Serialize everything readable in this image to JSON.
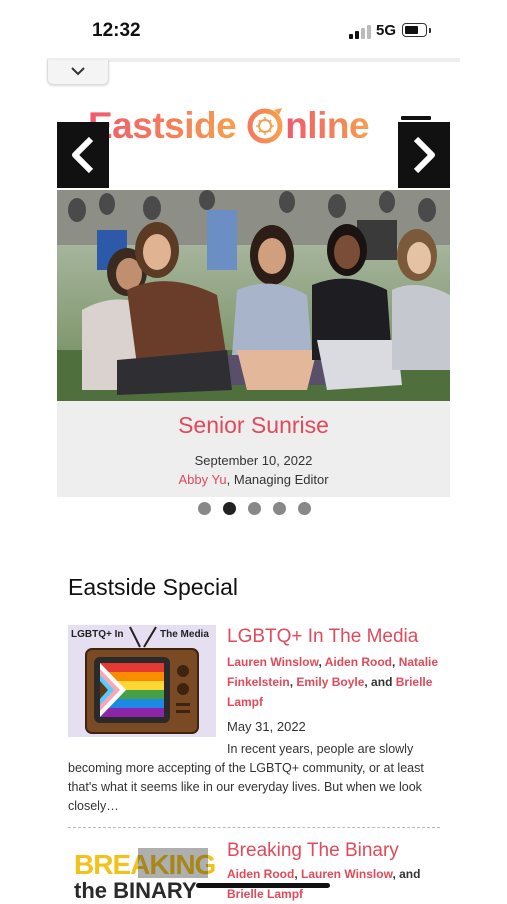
{
  "status_bar": {
    "time": "12:32",
    "network": "5G",
    "battery_percent": 70
  },
  "header": {
    "logo_text_before": "Eastside ",
    "logo_text_after": "nline",
    "menu_icon": "hamburger-icon",
    "collapse_icon": "chevron-down-icon"
  },
  "carousel": {
    "slide_title": "Senior Sunrise",
    "date": "September 10, 2022",
    "author": "Abby Yu",
    "author_role": ", Managing Editor",
    "prev_icon": "chevron-left-icon",
    "next_icon": "chevron-right-icon",
    "slide_count": 5,
    "active_index": 1
  },
  "section": {
    "title": "Eastside Special"
  },
  "articles": [
    {
      "title": "LGBTQ+ In The Media",
      "authors": [
        "Lauren Winslow",
        "Aiden Rood",
        "Natalie Finkelstein",
        "Emily Boyle",
        "Brielle Lampf"
      ],
      "date": "May 31, 2022",
      "excerpt": "In recent years, people are slowly becoming more accepting of the LGBTQ+ community, or at least that's what it seems like in our everyday lives. But when we look closely…",
      "thumb_text_left": "LGBTQ+ In",
      "thumb_text_right": "The Media"
    },
    {
      "title": "Breaking The Binary",
      "authors": [
        "Aiden Rood",
        "Lauren Winslow",
        "Brielle Lampf"
      ],
      "thumb_text_top": "BREAKING",
      "thumb_text_bottom": "the BINARY"
    }
  ],
  "colors": {
    "accent": "#e04a5a",
    "logo_gradient_start": "#ef5a6f",
    "logo_gradient_end": "#f6a04d"
  }
}
